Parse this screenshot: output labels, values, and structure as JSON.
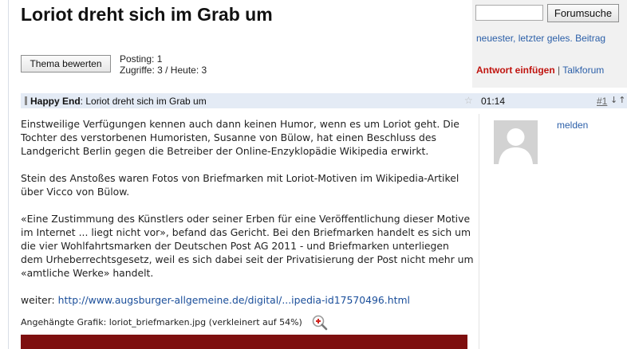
{
  "thread": {
    "title": "Loriot dreht sich im Grab um",
    "rate_button": "Thema bewerten",
    "postings": "Posting: 1",
    "hits": "Zugriffe: 3 / Heute: 3"
  },
  "sidebar": {
    "search_value": "",
    "search_button": "Forumsuche",
    "newest_link": "neuester, letzter geles. Beitrag",
    "reply_link": "Antwort einfügen",
    "separator": "|",
    "talkforum_link": "Talkforum"
  },
  "post": {
    "author": "Happy End",
    "subject": ": Loriot dreht sich im Grab um",
    "time": "01:14",
    "number": "#1",
    "nav_arrows": "↓↑",
    "report_link": "melden",
    "paragraphs": [
      "Einstweilige Verfügungen kennen auch dann keinen Humor, wenn es um Loriot geht. Die Tochter des verstorbenen Humoristen, Susanne von Bülow, hat einen Beschluss des Landgericht Berlin gegen die Betreiber der Online-Enzyklopädie Wikipedia erwirkt.",
      "Stein des Anstoßes waren Fotos von Briefmarken mit Loriot-Motiven im Wikipedia-Artikel über Vicco von Bülow.",
      "«Eine Zustimmung des Künstlers oder seiner Erben für eine Veröffentlichung dieser Motive im Internet ... liegt nicht vor», befand das Gericht. Bei den Briefmarken handelt es sich um die vier Wohlfahrtsmarken der Deutschen Post AG 2011 - und Briefmarken unterliegen dem Urheberrechtsgesetz, weil es sich dabei seit der Privatisierung der Post nicht mehr um «amtliche Werke» handelt."
    ],
    "source_label": "weiter: ",
    "source_url": "http://www.augsburger-allgemeine.de/digital/...ipedia-id17570496.html",
    "attachment": "Angehängte Grafik: loriot_briefmarken.jpg (verkleinert auf 54%)"
  },
  "icons": {
    "star": "star-icon",
    "zoom": "zoom-in-icon",
    "avatar": "default-user-avatar"
  },
  "colors": {
    "link": "#2b5fa8",
    "reply": "#c0140f",
    "post_bar": "#e4ebf5",
    "image_strip": "#7e0f0f"
  }
}
